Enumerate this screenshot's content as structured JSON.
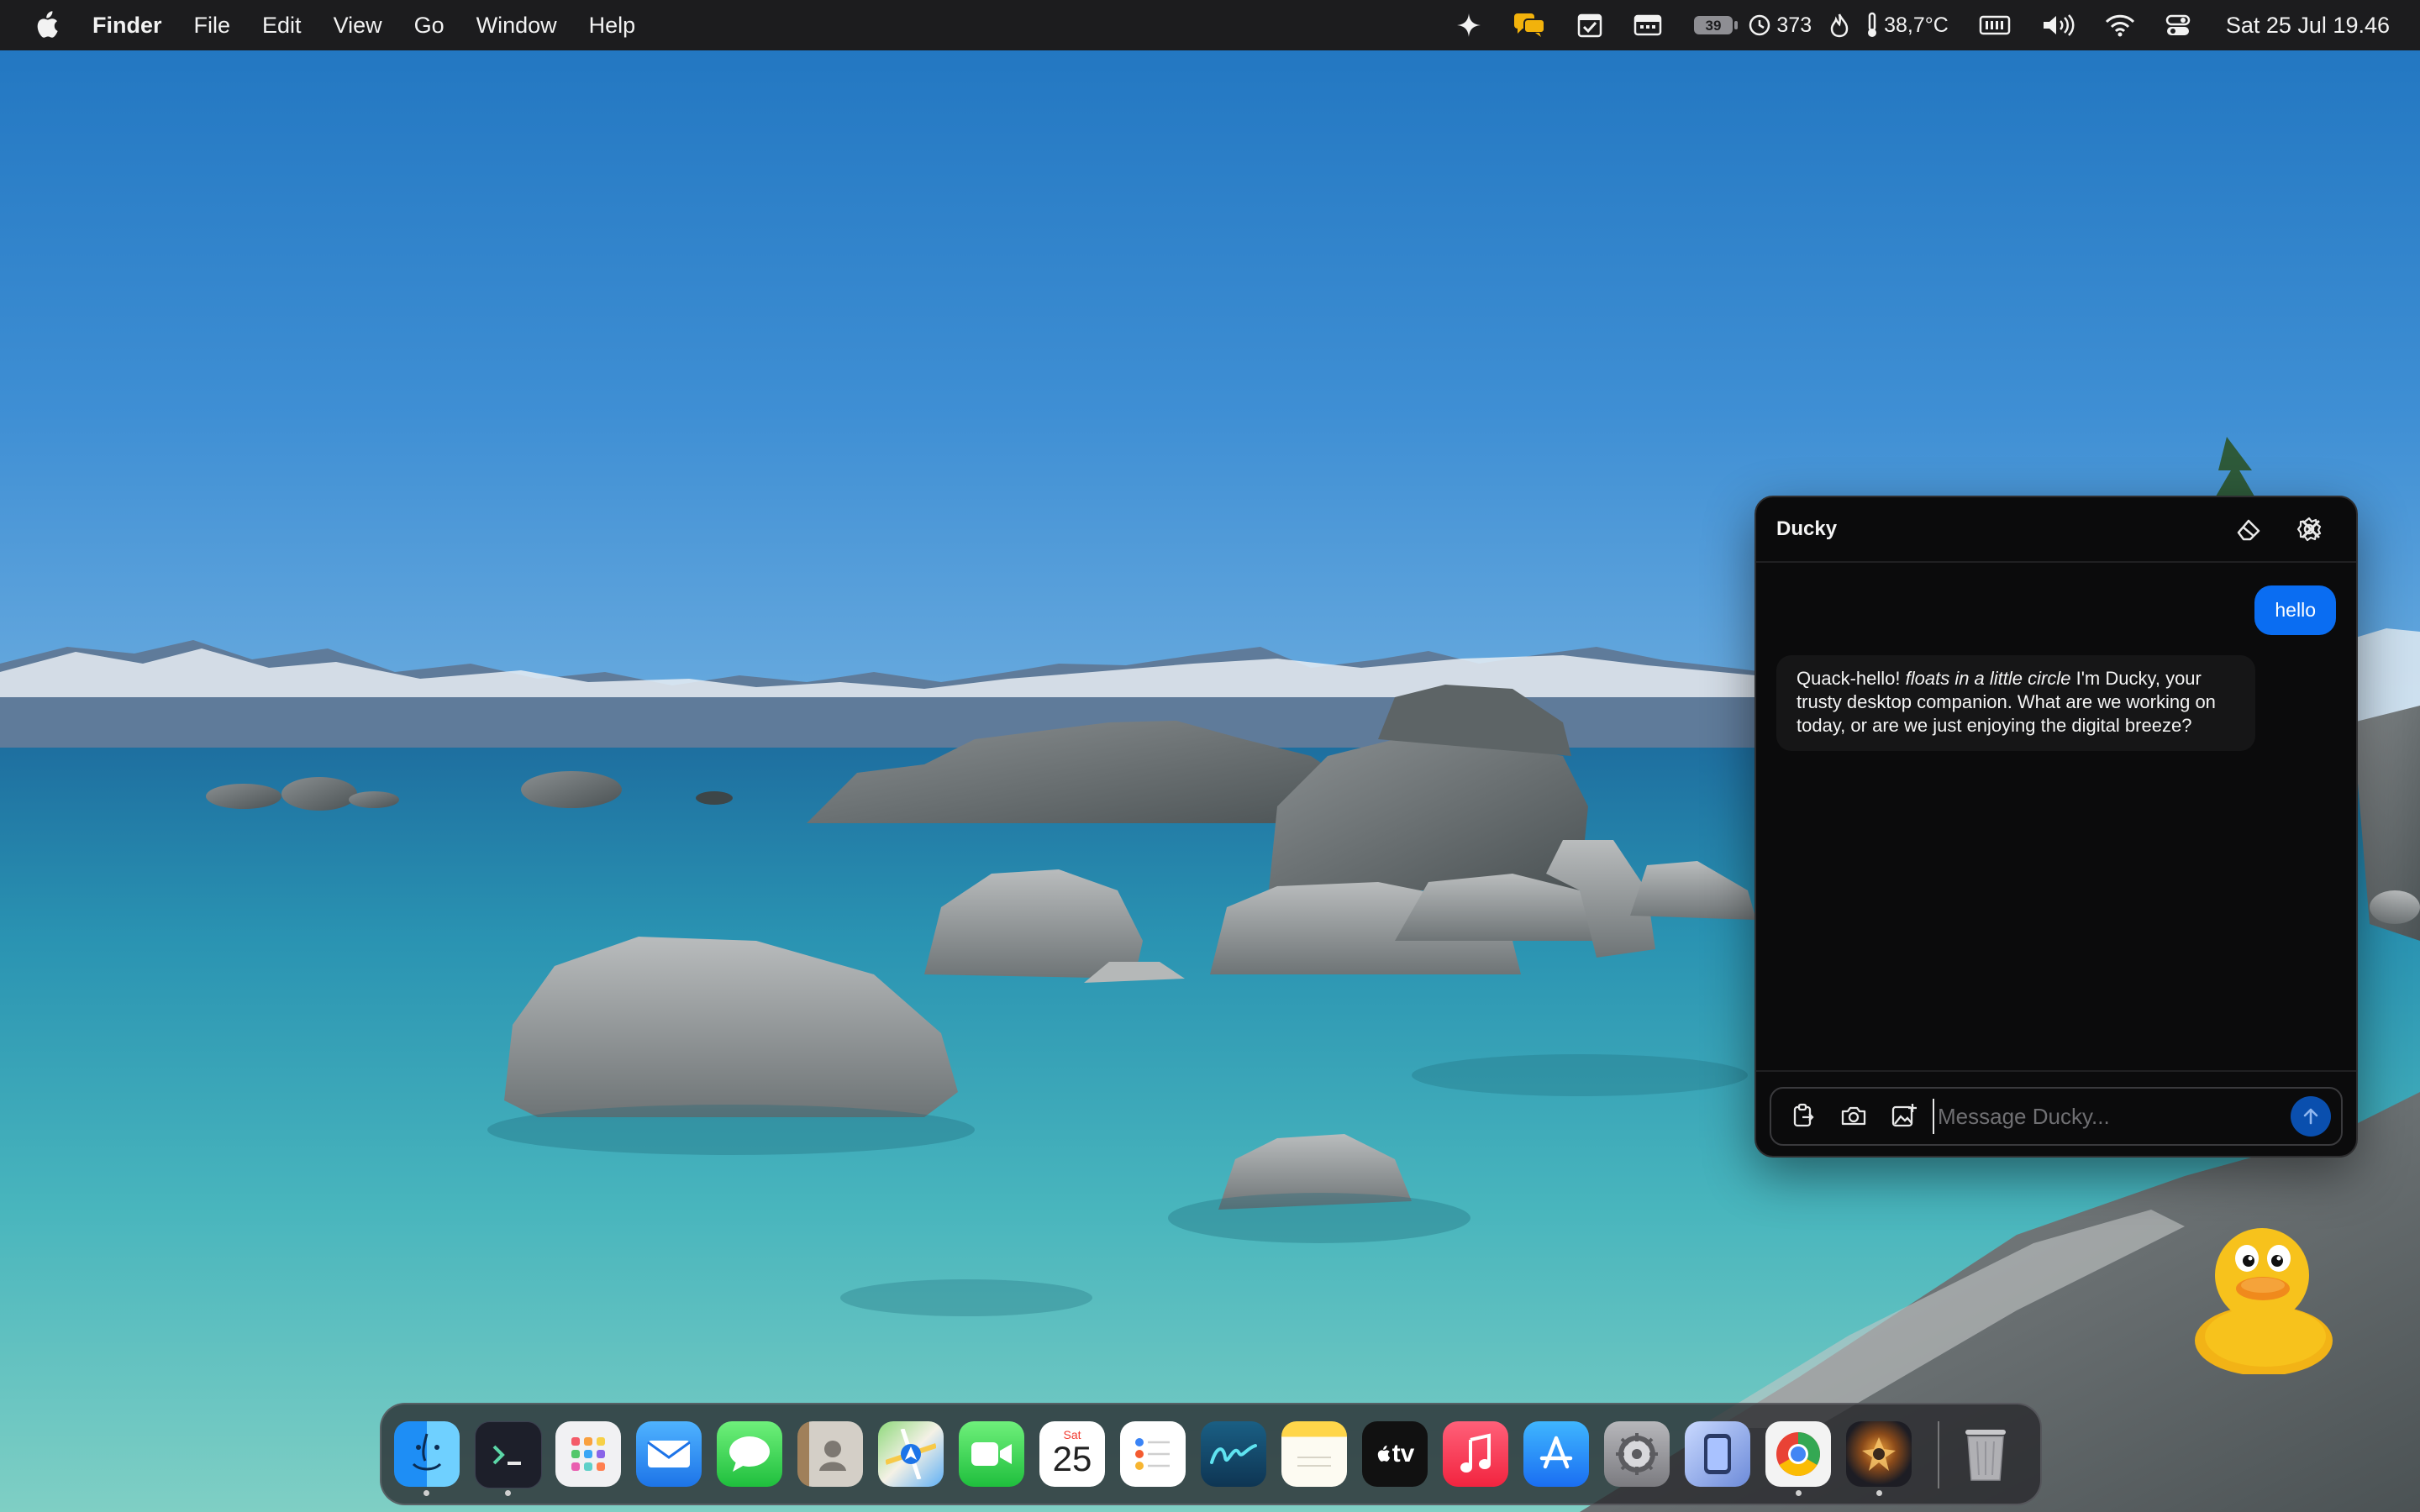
{
  "menubar": {
    "app_name": "Finder",
    "menus": [
      "File",
      "Edit",
      "View",
      "Go",
      "Window",
      "Help"
    ],
    "tray": {
      "battery_pct_label": "39",
      "history_count": "373",
      "temperature": "38,7°C"
    },
    "clock": "Sat 25 Jul  19.46"
  },
  "ducky": {
    "title": "Ducky",
    "messages": {
      "user": "hello",
      "bot_prefix": "Quack-hello! ",
      "bot_action": "floats in a little circle",
      "bot_suffix": " I'm Ducky, your trusty desktop companion. What are we working on today, or are we just enjoying the digital breeze?"
    },
    "input": {
      "placeholder": "Message Ducky...",
      "value": ""
    }
  },
  "dock": {
    "calendar_day_label": "Sat",
    "calendar_date": "25",
    "tv_label": "tv",
    "apps": [
      "Finder",
      "Terminal",
      "Launchpad",
      "Mail",
      "Messages",
      "Contacts",
      "Maps",
      "FaceTime",
      "Calendar",
      "Reminders",
      "Freeform",
      "Notes",
      "Apple TV",
      "Music",
      "App Store",
      "System Settings",
      "iPhone Mirroring",
      "Chrome",
      "Ducky",
      "Trash"
    ]
  },
  "colors": {
    "menubar_bg": "#1c1c1e",
    "window_bg": "#0b0b0c",
    "user_bubble": "#0a6df2",
    "bot_bubble": "#161617",
    "send_button": "#0a4fae",
    "duck_yellow": "#f7c21c"
  }
}
